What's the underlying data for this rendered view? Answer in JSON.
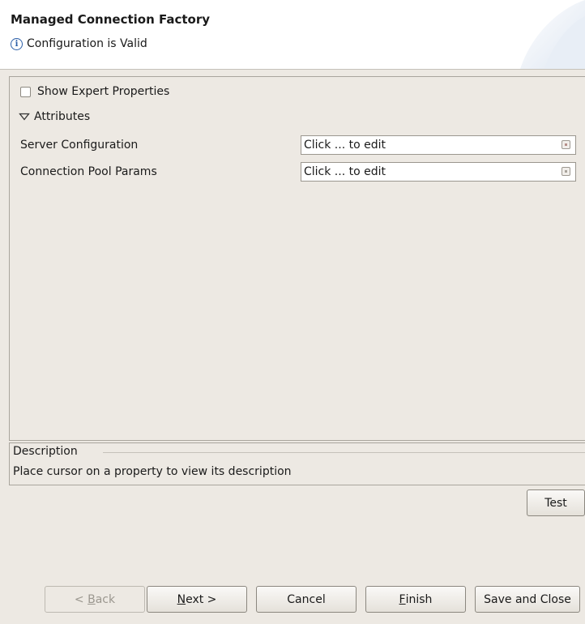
{
  "header": {
    "title": "Managed Connection Factory",
    "status": "Configuration is Valid"
  },
  "editor": {
    "show_expert_label": "Show Expert Properties",
    "show_expert_checked": false,
    "attributes_label": "Attributes",
    "properties": [
      {
        "label": "Server Configuration",
        "value": "Click ... to edit"
      },
      {
        "label": "Connection Pool Params",
        "value": "Click ... to edit"
      }
    ]
  },
  "description": {
    "title": "Description",
    "text": "Place cursor on a property to view its description"
  },
  "buttons": {
    "test": "Test",
    "back_mnemonic": "B",
    "back_rest": "ack",
    "back_prefix": "< ",
    "next_mnemonic": "N",
    "next_rest": "ext >",
    "cancel": "Cancel",
    "finish_mnemonic": "F",
    "finish_rest": "inish",
    "save_close": "Save and Close"
  },
  "colors": {
    "background": "#ede9e3",
    "header_bg": "#ffffff",
    "info_accent": "#2c5fa8"
  },
  "icons": [
    "info-icon",
    "banner-graphic",
    "expand-triangle-icon",
    "edit-ellipsis-icon"
  ]
}
